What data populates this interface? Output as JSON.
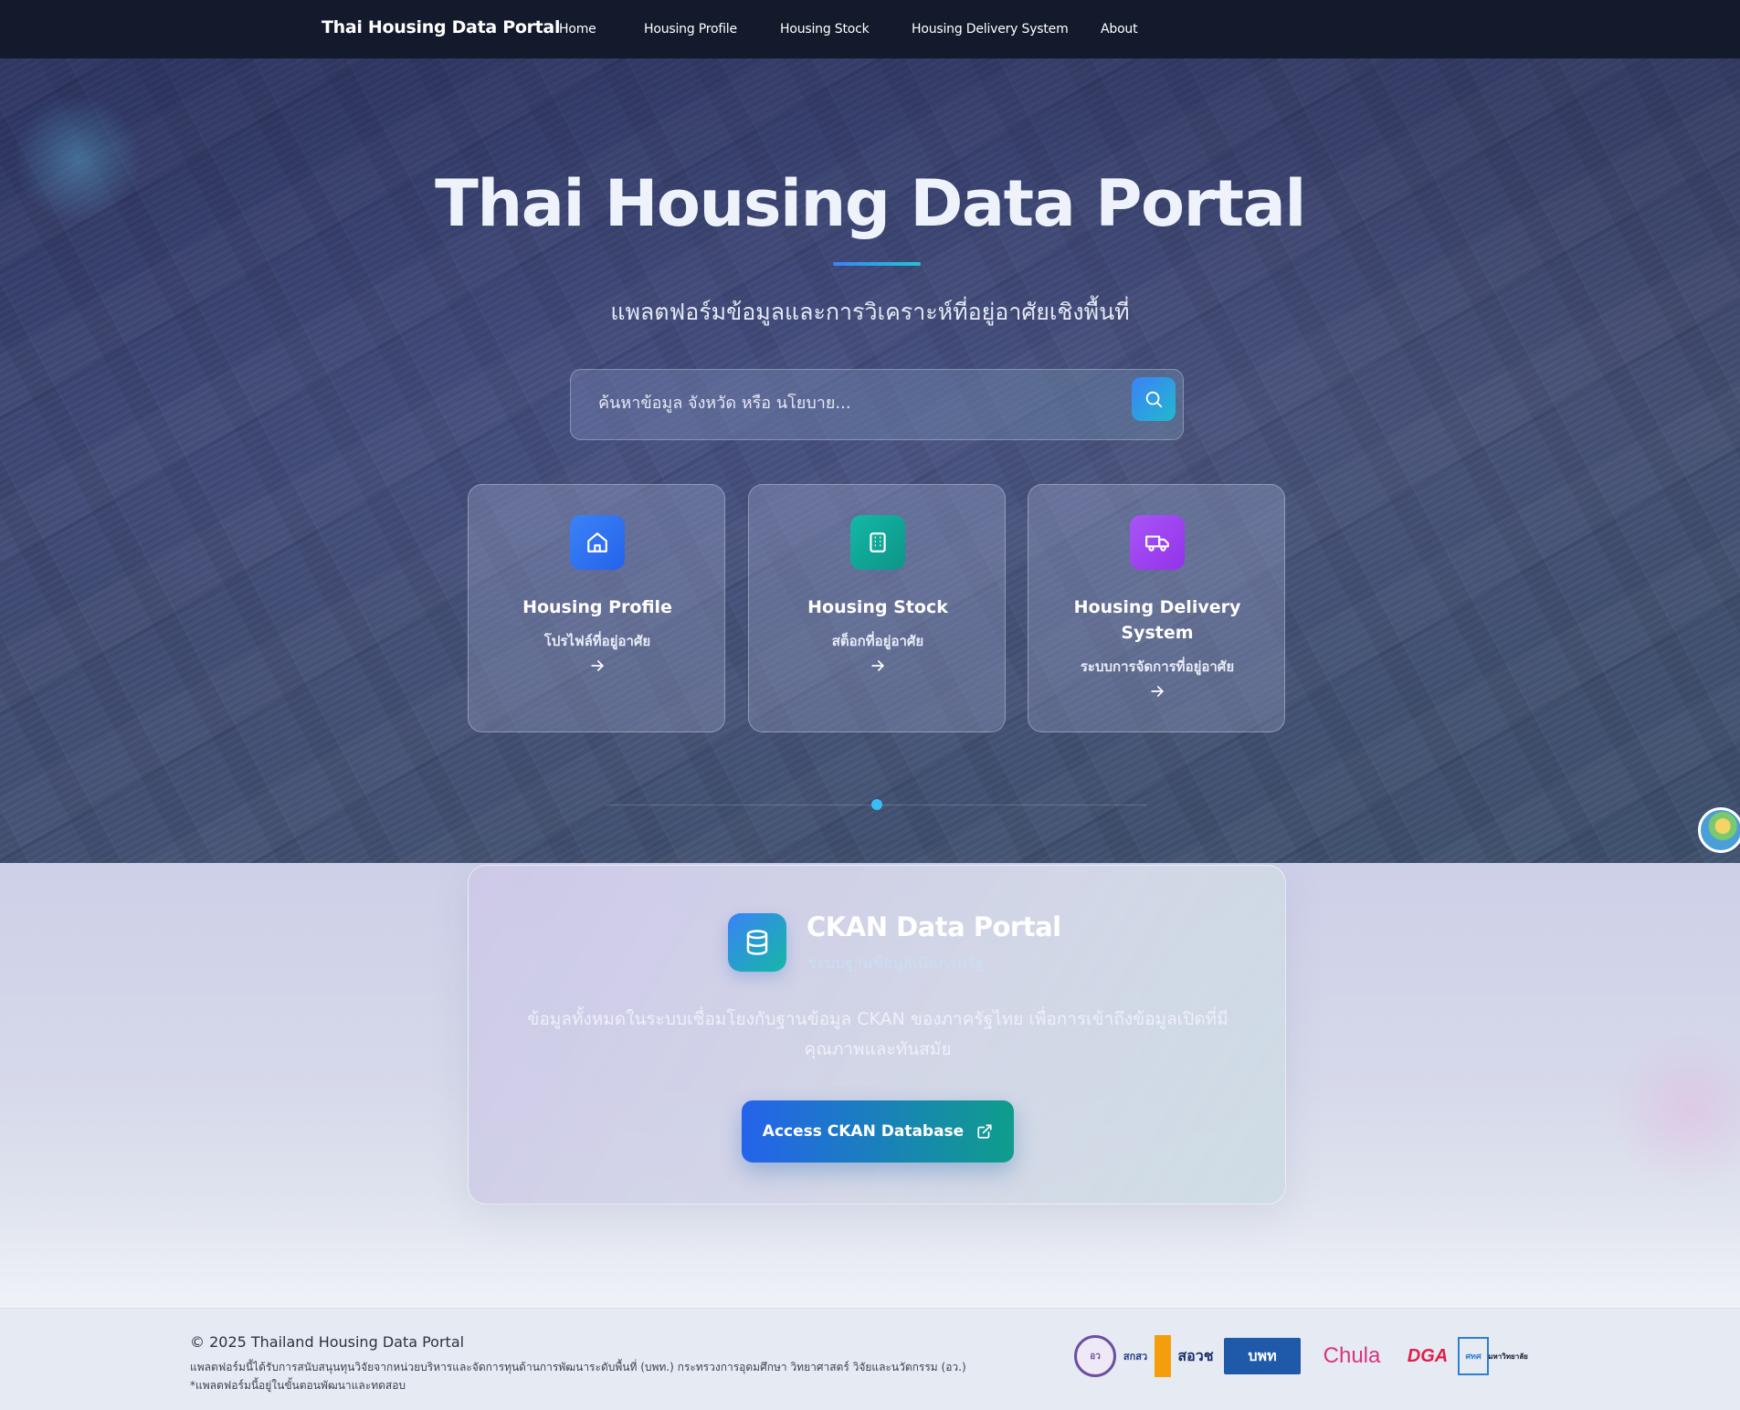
{
  "nav": {
    "brand": "Thai Housing Data Portal",
    "links": [
      "Home",
      "Housing Profile",
      "Housing Stock",
      "Housing Delivery System",
      "About"
    ]
  },
  "hero": {
    "title": "Thai Housing Data Portal",
    "subtitle": "แพลตฟอร์มข้อมูลและการวิเคราะห์ที่อยู่อาศัยเชิงพื้นที่",
    "search": {
      "placeholder": "ค้นหาข้อมูล จังหวัด หรือ นโยบาย..."
    },
    "cards": [
      {
        "title": "Housing Profile",
        "subtitle": "โปรไฟล์ที่อยู่อาศัย",
        "icon": "home-icon",
        "color": "#3b82f6"
      },
      {
        "title": "Housing Stock",
        "subtitle": "สต็อกที่อยู่อาศัย",
        "icon": "building-icon",
        "color": "#14b8a6"
      },
      {
        "title": "Housing Delivery System",
        "subtitle": "ระบบการจัดการที่อยู่อาศัย",
        "icon": "truck-icon",
        "color": "#a855f7"
      }
    ]
  },
  "ckan": {
    "title": "CKAN Data Portal",
    "subtitle": "ระบบฐานข้อมูลเปิดภาครัฐ",
    "description": "ข้อมูลทั้งหมดในระบบเชื่อมโยงกับฐานข้อมูล CKAN ของภาครัฐไทย เพื่อการเข้าถึงข้อมูลเปิดที่มีคุณภาพและทันสมัย",
    "button_label": "Access CKAN Database"
  },
  "footer": {
    "copyright": "© 2025 Thailand Housing Data Portal",
    "note1": "แพลตฟอร์มนี้ได้รับการสนับสนุนทุนวิจัยจากหน่วยบริหารและจัดการทุนด้านการพัฒนาระดับพื้นที่ (บพท.) กระทรวงการอุดมศึกษา วิทยาศาสตร์ วิจัยและนวัตกรรม (อว.)",
    "note2": "*แพลตฟอร์มนี้อยู่ในขั้นตอนพัฒนาและทดสอบ",
    "logos": [
      "อว",
      "สกสว",
      "สอวช",
      "บพท",
      "Chula",
      "DGA",
      "ศทศ",
      "มหาวิทยาลัย"
    ]
  },
  "colors": {
    "nav_bg": "#121a2b",
    "accent": "#3b82f6",
    "teal": "#14b8a6",
    "purple": "#a855f7"
  }
}
